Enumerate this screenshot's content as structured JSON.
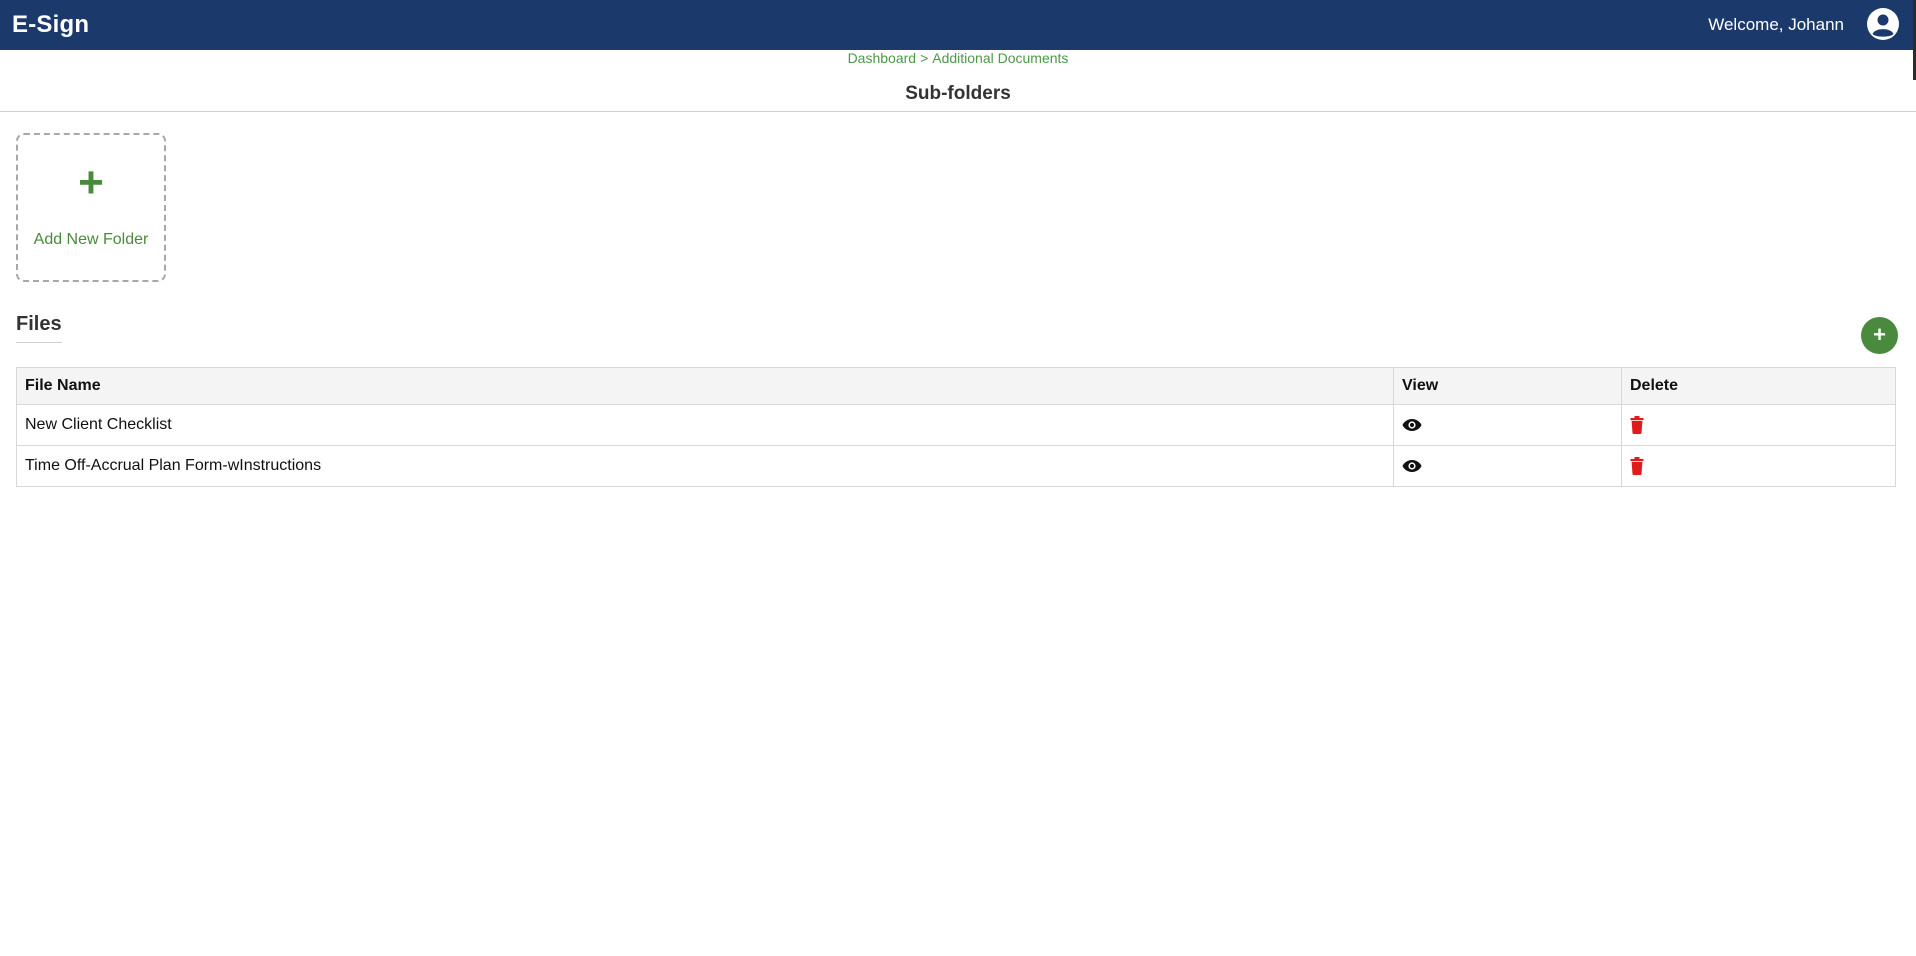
{
  "header": {
    "brand": "E-Sign",
    "welcome": "Welcome, Johann",
    "avatar_icon": "user-circle-icon"
  },
  "breadcrumb": {
    "items": [
      "Dashboard",
      "Additional Documents"
    ],
    "separator": ">"
  },
  "page": {
    "title": "Sub-folders"
  },
  "add_folder": {
    "icon": "+",
    "label": "Add New Folder"
  },
  "files": {
    "heading": "Files",
    "add_button_icon": "+",
    "columns": [
      "File Name",
      "View",
      "Delete"
    ],
    "rows": [
      {
        "name": "New Client Checklist",
        "view_icon": "eye-icon",
        "delete_icon": "trash-icon"
      },
      {
        "name": "Time Off-Accrual Plan Form-wInstructions",
        "view_icon": "eye-icon",
        "delete_icon": "trash-icon"
      }
    ]
  },
  "colors": {
    "header_bg": "#1b3a6b",
    "accent_green": "#4a8a3e",
    "link_green": "#4a9a46",
    "delete_red": "#e01b1b"
  }
}
